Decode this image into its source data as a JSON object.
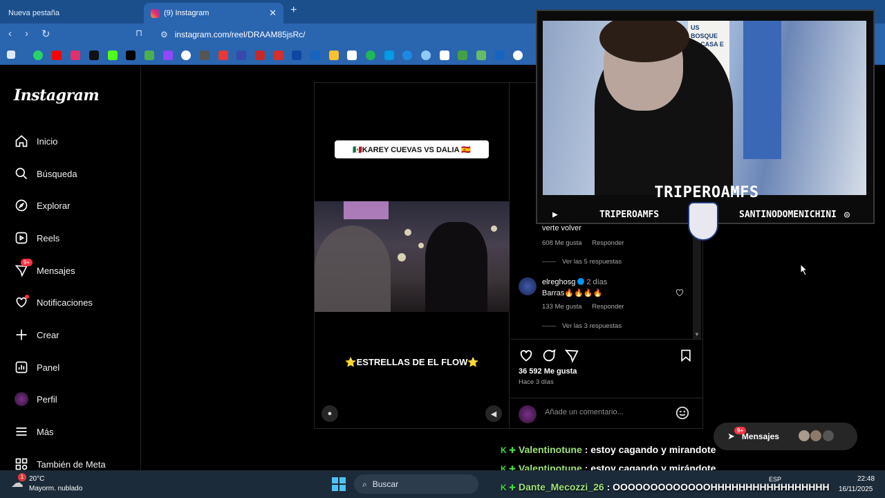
{
  "browser": {
    "tabs": [
      {
        "label": "Nueva pestaña"
      },
      {
        "label": "(9) Instagram"
      }
    ],
    "close_glyph": "✕",
    "new_tab_glyph": "+",
    "url": "instagram.com/reel/DRAAM85jsRc/"
  },
  "instagram": {
    "logo": "Instagram",
    "nav": [
      {
        "label": "Inicio",
        "icon": "home-icon"
      },
      {
        "label": "Búsqueda",
        "icon": "search-icon"
      },
      {
        "label": "Explorar",
        "icon": "compass-icon"
      },
      {
        "label": "Reels",
        "icon": "reels-icon"
      },
      {
        "label": "Mensajes",
        "icon": "messenger-icon",
        "badge": "9+"
      },
      {
        "label": "Notificaciones",
        "icon": "heart-icon"
      },
      {
        "label": "Crear",
        "icon": "plus-icon"
      },
      {
        "label": "Panel",
        "icon": "chart-icon"
      },
      {
        "label": "Perfil",
        "icon": "avatar-icon"
      },
      {
        "label": "Más",
        "icon": "menu-icon"
      },
      {
        "label": "También de Meta",
        "icon": "meta-icon"
      }
    ],
    "reel": {
      "title": "🇲🇽KAREY CUEVAS VS DALIA 🇪🇸",
      "caption": "⭐ESTRELLAS DE EL FLOW⭐"
    },
    "comments": [
      {
        "text": "verte volver",
        "likes": "608 Me gusta",
        "reply": "Responder",
        "replies": "Ver las 5 respuestas"
      },
      {
        "user": "elreghosg",
        "time": "2 días",
        "text": "Barras🔥🔥🔥🔥",
        "likes": "133 Me gusta",
        "reply": "Responder",
        "replies": "Ver las 3 respuestas"
      }
    ],
    "likes_count": "36 592 Me gusta",
    "posted_ago": "Hace 3 días",
    "comment_placeholder": "Añade un comentario...",
    "messages_pill": {
      "label": "Mensajes",
      "badge": "9+"
    }
  },
  "stream": {
    "streamer_name": "TRIPEROAMFS",
    "youtube": "TRIPEROAMFS",
    "instagram": "SANTINODOMENICHINI",
    "poster_text": "US BOSQUE LA CASA E AMA"
  },
  "chat": [
    {
      "user": "Valentinotune",
      "message": ": estoy cagando y mirandote"
    },
    {
      "user": "Valentinotune",
      "message": ": estoy cagando y mirándote"
    },
    {
      "user": "Dante_Mecozzi_26",
      "message": ": OOOOOOOOOOOOOHHHHHHHHHHHHHHHHH"
    }
  ],
  "taskbar": {
    "temp": "20°C",
    "weather": "Mayorm. nublado",
    "weather_badge": "1",
    "search": "Buscar",
    "lang": "ESP",
    "time": "22:48",
    "date": "16/11/2025"
  },
  "colors": {
    "chrome_tab": "#1b4f8c",
    "chrome_bar": "#2a65b0",
    "ig_bg": "#000000",
    "notif_red": "#ff3040",
    "chat_green": "#3fdc3f"
  }
}
